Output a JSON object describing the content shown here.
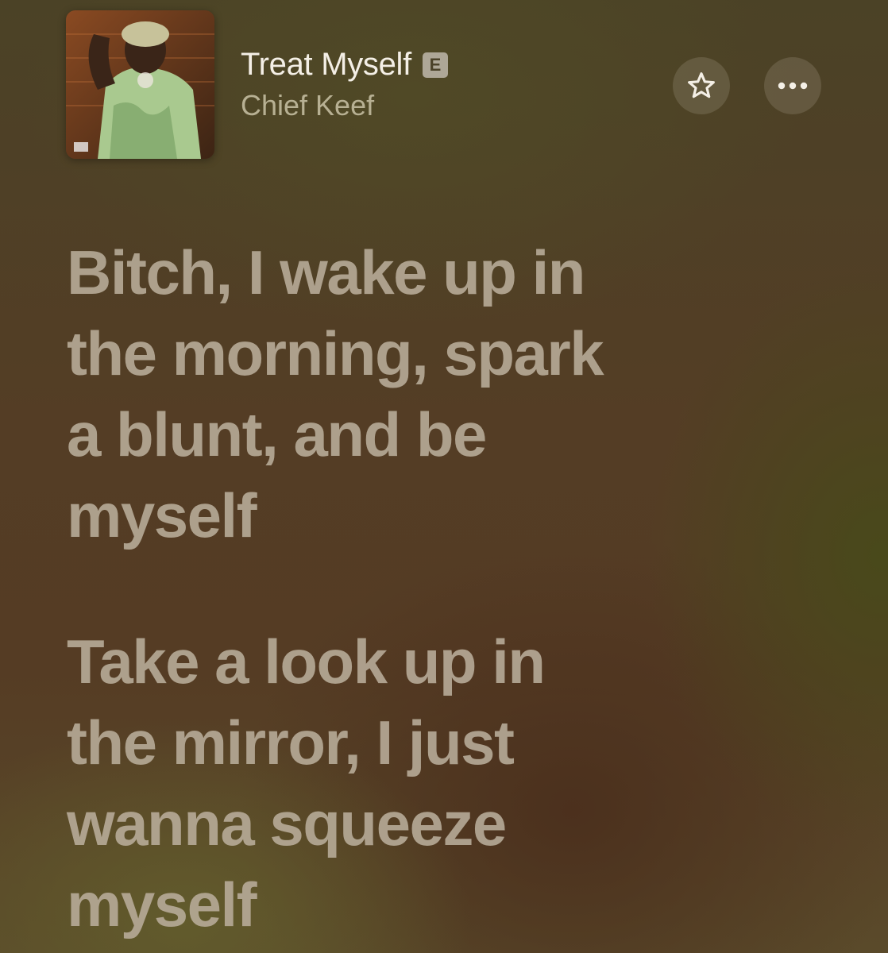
{
  "now_playing": {
    "title": "Treat Myself",
    "explicit_badge": "E",
    "artist": "Chief Keef",
    "album_art_icon": "album-cover-image"
  },
  "controls": {
    "favorite_icon": "star-icon",
    "more_icon": "ellipsis-icon"
  },
  "lyrics": [
    {
      "rows": [
        "Bitch, I wake up in",
        "the morning, spark",
        "a blunt, and be",
        "myself"
      ]
    },
    {
      "rows": [
        "Take a look up in",
        "the mirror, I just",
        "wanna squeeze",
        "myself"
      ]
    }
  ],
  "colors": {
    "title": "#f4efe6",
    "artist": "#b7b093",
    "lyric_text": "#b7ab98",
    "button_bg": "rgba(255,248,230,0.13)"
  }
}
